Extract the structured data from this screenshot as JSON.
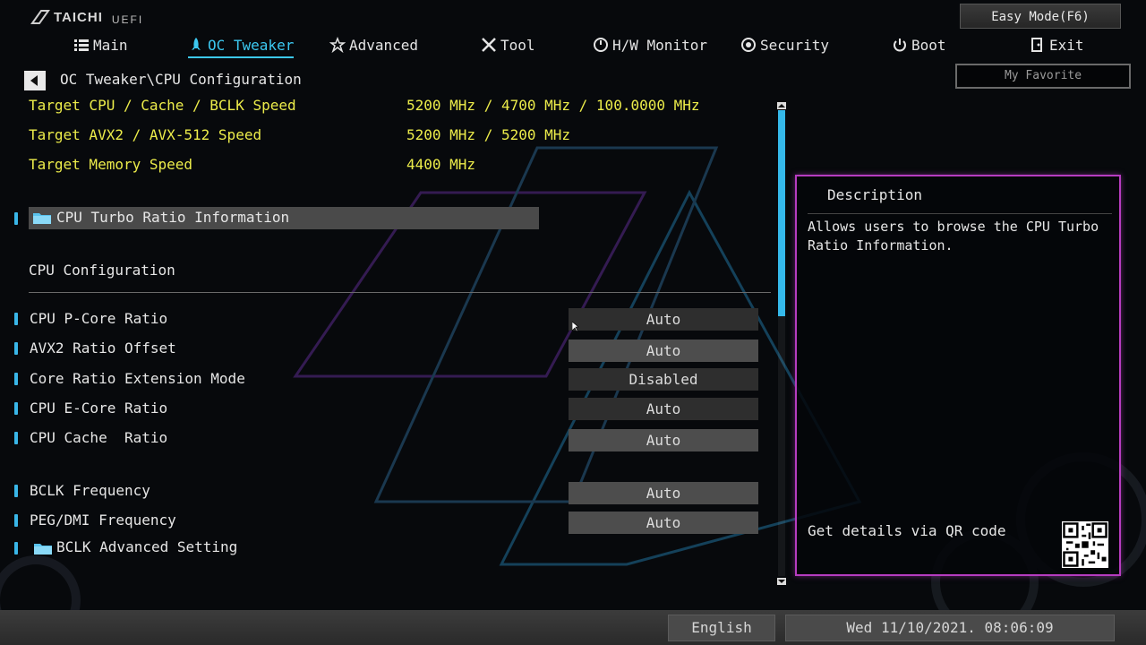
{
  "brand": {
    "name": "TAICHI",
    "sub": "UEFI"
  },
  "top_buttons": {
    "easy_mode": "Easy Mode(F6)",
    "my_favorite": "My Favorite"
  },
  "nav": {
    "tabs": [
      {
        "label": "Main",
        "icon": "list-icon",
        "active": false
      },
      {
        "label": "OC Tweaker",
        "icon": "rocket-icon",
        "active": true
      },
      {
        "label": "Advanced",
        "icon": "star-icon",
        "active": false
      },
      {
        "label": "Tool",
        "icon": "tools-icon",
        "active": false
      },
      {
        "label": "H/W Monitor",
        "icon": "monitor-icon",
        "active": false
      },
      {
        "label": "Security",
        "icon": "shield-icon",
        "active": false
      },
      {
        "label": "Boot",
        "icon": "power-icon",
        "active": false
      },
      {
        "label": "Exit",
        "icon": "exit-icon",
        "active": false
      }
    ]
  },
  "breadcrumb": "OC Tweaker\\CPU Configuration",
  "targets": [
    {
      "label": "Target CPU / Cache / BCLK Speed",
      "value": "5200 MHz / 4700 MHz / 100.0000 MHz"
    },
    {
      "label": "Target AVX2 / AVX-512 Speed",
      "value": "5200 MHz / 5200 MHz"
    },
    {
      "label": "Target Memory Speed",
      "value": "4400 MHz"
    }
  ],
  "submenus": {
    "turbo_ratio": "CPU Turbo Ratio Information",
    "bclk_advanced": "BCLK Advanced Setting"
  },
  "section_title": "CPU Configuration",
  "settings": [
    {
      "label": "CPU P-Core Ratio",
      "value": "Auto"
    },
    {
      "label": "AVX2 Ratio Offset",
      "value": "Auto"
    },
    {
      "label": "Core Ratio Extension Mode",
      "value": "Disabled"
    },
    {
      "label": "CPU E-Core Ratio",
      "value": "Auto"
    },
    {
      "label": "CPU Cache  Ratio",
      "value": "Auto"
    },
    {
      "label": "BCLK Frequency",
      "value": "Auto"
    },
    {
      "label": "PEG/DMI Frequency",
      "value": "Auto"
    }
  ],
  "description": {
    "title": "Description",
    "text": "Allows users to browse the CPU Turbo\nRatio Information.",
    "qr_label": "Get details via QR code"
  },
  "status_bar": {
    "language": "English",
    "datetime": "Wed 11/10/2021. 08:06:09"
  },
  "colors": {
    "accent": "#3cc8f0",
    "highlight": "#ecec4a",
    "panel_border": "#b63cc0"
  }
}
